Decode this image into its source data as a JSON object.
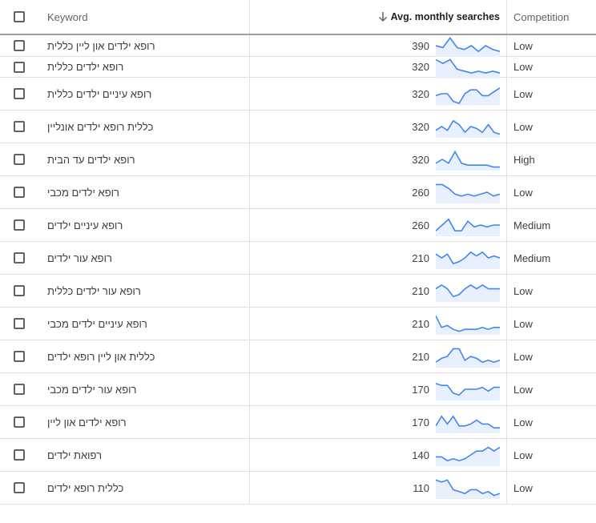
{
  "header": {
    "keyword_label": "Keyword",
    "searches_label": "Avg. monthly searches",
    "competition_label": "Competition",
    "sort_icon": "arrow-down-icon"
  },
  "colors": {
    "sparkline": "#4285f4",
    "sparkline_fill": "#e8f0fe"
  },
  "rows": [
    {
      "keyword": "רופא ילדים און ליין כללית",
      "searches": "390",
      "competition": "Low",
      "trend": [
        5,
        4,
        9,
        4,
        3,
        5,
        2,
        5,
        3,
        2
      ]
    },
    {
      "keyword": "רופא ילדים כללית",
      "searches": "320",
      "competition": "Low",
      "trend": [
        9,
        7,
        9,
        4,
        3,
        2,
        3,
        2,
        3,
        2
      ]
    },
    {
      "keyword": "רופא עיניים ילדים כללית",
      "searches": "320",
      "competition": "Low",
      "trend": [
        4,
        5,
        5,
        1,
        0,
        5,
        7,
        7,
        4,
        4,
        6,
        8
      ]
    },
    {
      "keyword": "כללית רופא ילדים אונליין",
      "searches": "320",
      "competition": "Low",
      "trend": [
        3,
        5,
        3,
        8,
        6,
        2,
        5,
        4,
        2,
        6,
        2,
        1
      ]
    },
    {
      "keyword": "רופא ילדים עד הבית",
      "searches": "320",
      "competition": "High",
      "trend": [
        3,
        5,
        3,
        9,
        3,
        2,
        2,
        2,
        2,
        1,
        1
      ]
    },
    {
      "keyword": "רופא ילדים מכבי",
      "searches": "260",
      "competition": "Low",
      "trend": [
        9,
        9,
        7,
        4,
        3,
        4,
        3,
        4,
        5,
        3,
        4
      ]
    },
    {
      "keyword": "רופא עיניים ילדים",
      "searches": "260",
      "competition": "Medium",
      "trend": [
        2,
        5,
        8,
        2,
        2,
        7,
        4,
        5,
        4,
        5,
        5
      ]
    },
    {
      "keyword": "רופא עור ילדים",
      "searches": "210",
      "competition": "Medium",
      "trend": [
        7,
        5,
        7,
        2,
        3,
        5,
        8,
        6,
        8,
        5,
        6,
        5
      ]
    },
    {
      "keyword": "רופא עור ילדים כללית",
      "searches": "210",
      "competition": "Low",
      "trend": [
        6,
        8,
        6,
        2,
        3,
        6,
        8,
        6,
        8,
        6,
        6,
        6
      ]
    },
    {
      "keyword": "רופא עיניים ילדים מכבי",
      "searches": "210",
      "competition": "Low",
      "trend": [
        9,
        3,
        4,
        2,
        1,
        2,
        2,
        2,
        3,
        2,
        3,
        3
      ]
    },
    {
      "keyword": "כללית און ליין רופא ילדים",
      "searches": "210",
      "competition": "Low",
      "trend": [
        2,
        4,
        5,
        9,
        9,
        3,
        5,
        4,
        2,
        3,
        2,
        3
      ]
    },
    {
      "keyword": "רופא עור ילדים מכבי",
      "searches": "170",
      "competition": "Low",
      "trend": [
        8,
        7,
        7,
        3,
        2,
        5,
        5,
        5,
        6,
        4,
        6,
        6
      ]
    },
    {
      "keyword": "רופא ילדים און ליין",
      "searches": "170",
      "competition": "Low",
      "trend": [
        3,
        8,
        4,
        8,
        3,
        3,
        4,
        6,
        4,
        4,
        2,
        2
      ]
    },
    {
      "keyword": "רפואת ילדים",
      "searches": "140",
      "competition": "Low",
      "trend": [
        4,
        4,
        2,
        3,
        2,
        3,
        5,
        7,
        7,
        9,
        7,
        9
      ]
    },
    {
      "keyword": "כללית רופא ילדים",
      "searches": "110",
      "competition": "Low",
      "trend": [
        9,
        8,
        9,
        4,
        3,
        2,
        4,
        4,
        2,
        3,
        1,
        2
      ]
    }
  ]
}
